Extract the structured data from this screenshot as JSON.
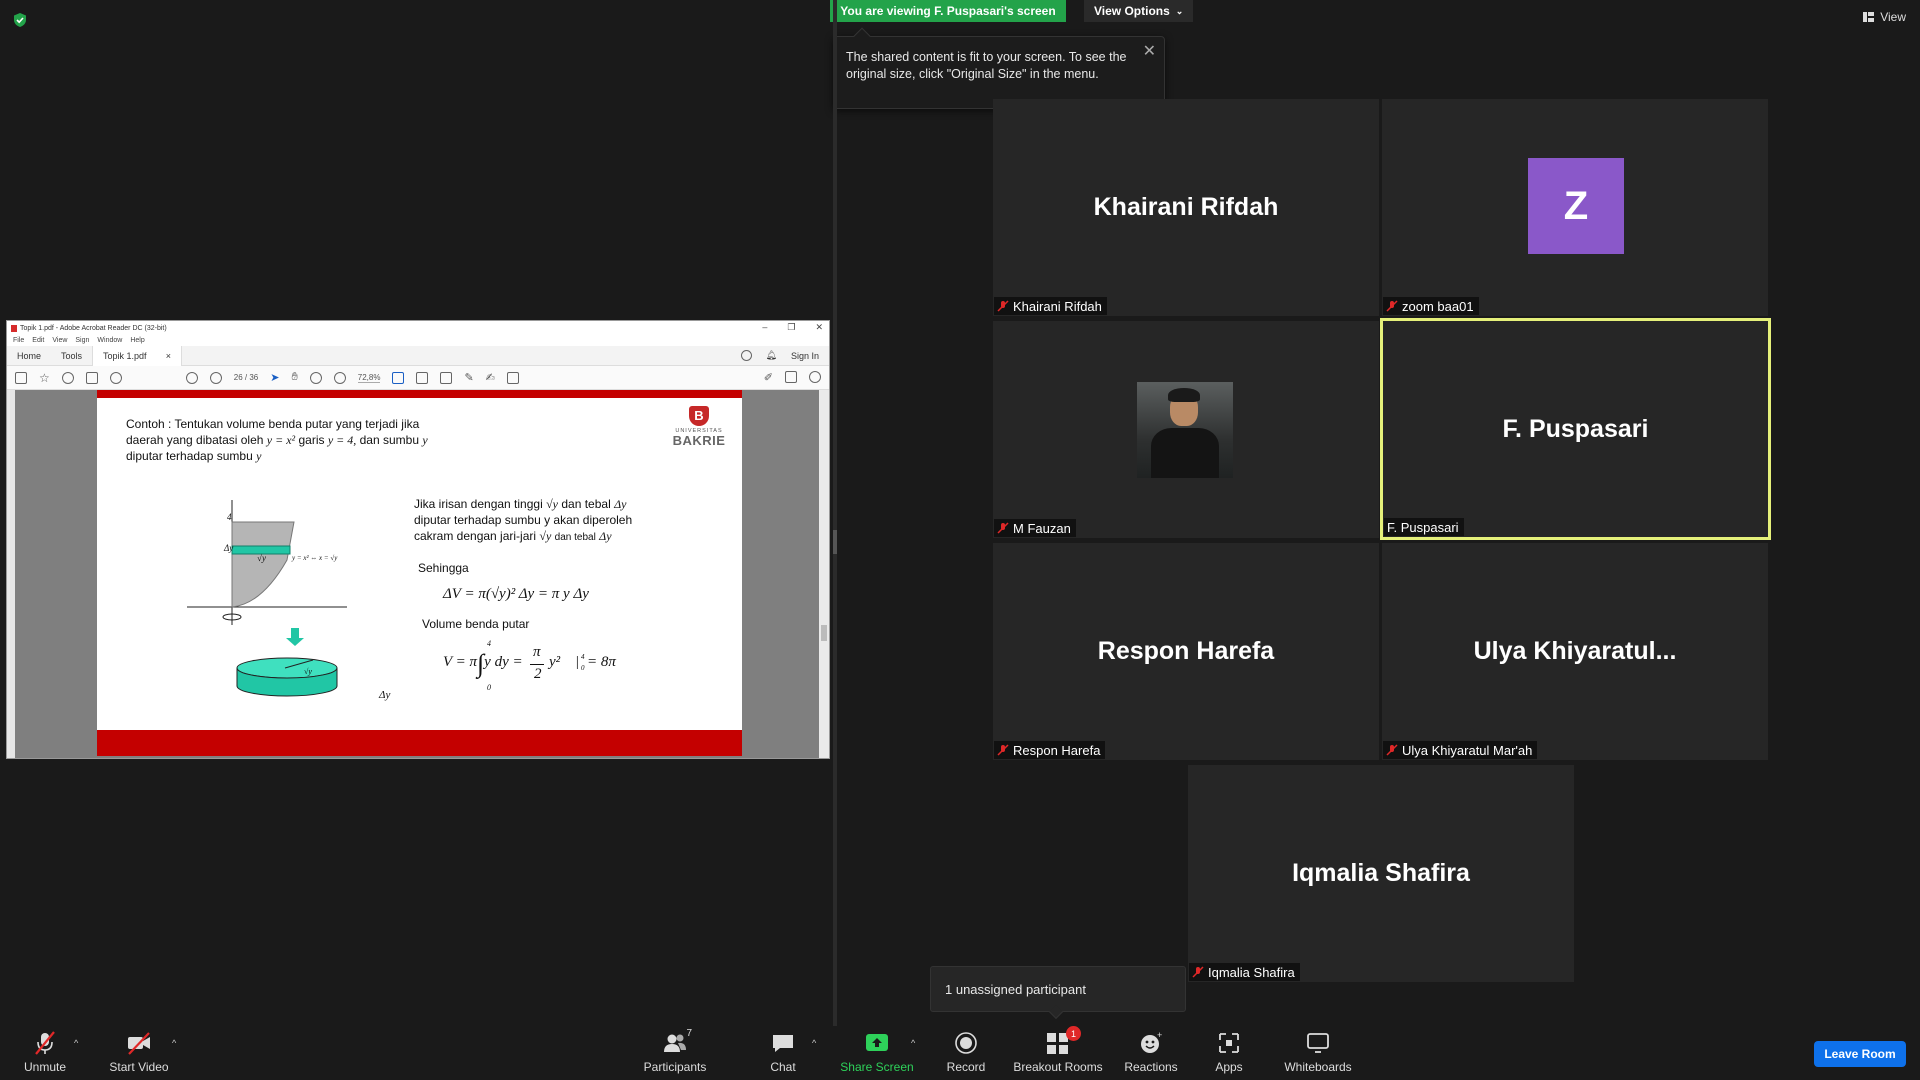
{
  "banner": {
    "viewing_text": "You are viewing F. Puspasari's screen",
    "view_options_label": "View Options",
    "view_label": "View"
  },
  "tooltip": {
    "text": "The shared content is fit to your screen. To see the original size, click \"Original Size\" in the menu."
  },
  "acrobat": {
    "title": "Topik 1.pdf - Adobe Acrobat Reader DC (32-bit)",
    "menu": [
      "File",
      "Edit",
      "View",
      "Sign",
      "Window",
      "Help"
    ],
    "tabs": {
      "home": "Home",
      "tools": "Tools",
      "doc": "Topik 1.pdf",
      "close": "×"
    },
    "sign_in": "Sign In",
    "page_current": "26",
    "page_total": "/ 36",
    "zoom": "72,8%"
  },
  "pdf": {
    "logo_small": "UNIVERSITAS",
    "logo_big": "BAKRIE",
    "line1": "Contoh : Tentukan volume benda putar yang terjadi jika",
    "line2a": "daerah yang dibatasi oleh",
    "line2m": "y = x²",
    "line2b": "garis",
    "line2c": "y = 4,",
    "line2d": "dan sumbu",
    "line2e": "y",
    "line3a": "diputar terhadap sumbu",
    "line3b": "y",
    "r1a": "Jika irisan dengan tinggi",
    "r1m": "√y",
    "r1b": "dan tebal",
    "r1c": "Δy",
    "r2": "diputar terhadap sumbu y akan diperoleh",
    "r3a": "cakram dengan jari-jari",
    "r3m": "√y",
    "r3b": "dan tebal",
    "r3c": "Δy",
    "sehingga": "Sehingga",
    "formula1": "ΔV = π(√y)² Δy = π y Δy",
    "volume_label": "Volume benda putar",
    "formula2a": "V = π",
    "formula2b": "y dy =",
    "formula2c": "π",
    "formula2d": "2",
    "formula2e": "y²",
    "formula2f": "|",
    "formula2g": "= 8π",
    "int_upper": "4",
    "int_lower": "0",
    "eval_upper": "4",
    "eval_lower": "0",
    "graph_4": "4",
    "graph_dy": "Δy",
    "graph_sqrt": "√y",
    "graph_curve": "y = x² ⇔ x = √y",
    "disk_sqrt": "√y",
    "disk_dy": "Δy"
  },
  "tiles": [
    {
      "big_name": "Khairani Rifdah",
      "label": "Khairani Rifdah",
      "type": "name"
    },
    {
      "avatar_letter": "Z",
      "label": "zoom baa01",
      "type": "avatar"
    },
    {
      "label": "M Fauzan",
      "type": "photo"
    },
    {
      "big_name": "F. Puspasari",
      "label": "F. Puspasari",
      "type": "name",
      "active": true
    },
    {
      "big_name": "Respon Harefa",
      "label": "Respon Harefa",
      "type": "name"
    },
    {
      "big_name": "Ulya  Khiyaratul...",
      "label": "Ulya Khiyaratul Mar'ah",
      "type": "name"
    },
    {
      "big_name": "Iqmalia Shafira",
      "label": "Iqmalia Shafira",
      "type": "name"
    }
  ],
  "notice": "1 unassigned participant",
  "toolbar": {
    "unmute": "Unmute",
    "start_video": "Start Video",
    "participants": "Participants",
    "participants_count": "7",
    "chat": "Chat",
    "share_screen": "Share Screen",
    "record": "Record",
    "breakout_rooms": "Breakout Rooms",
    "breakout_badge": "1",
    "reactions": "Reactions",
    "apps": "Apps",
    "whiteboards": "Whiteboards",
    "leave_room": "Leave Room"
  },
  "colors": {
    "share_green": "#23a34a",
    "active_speaker": "#e5f07a",
    "avatar_purple": "#8a58c9",
    "leave_blue": "#0e71eb",
    "mute_red": "#e02828"
  }
}
